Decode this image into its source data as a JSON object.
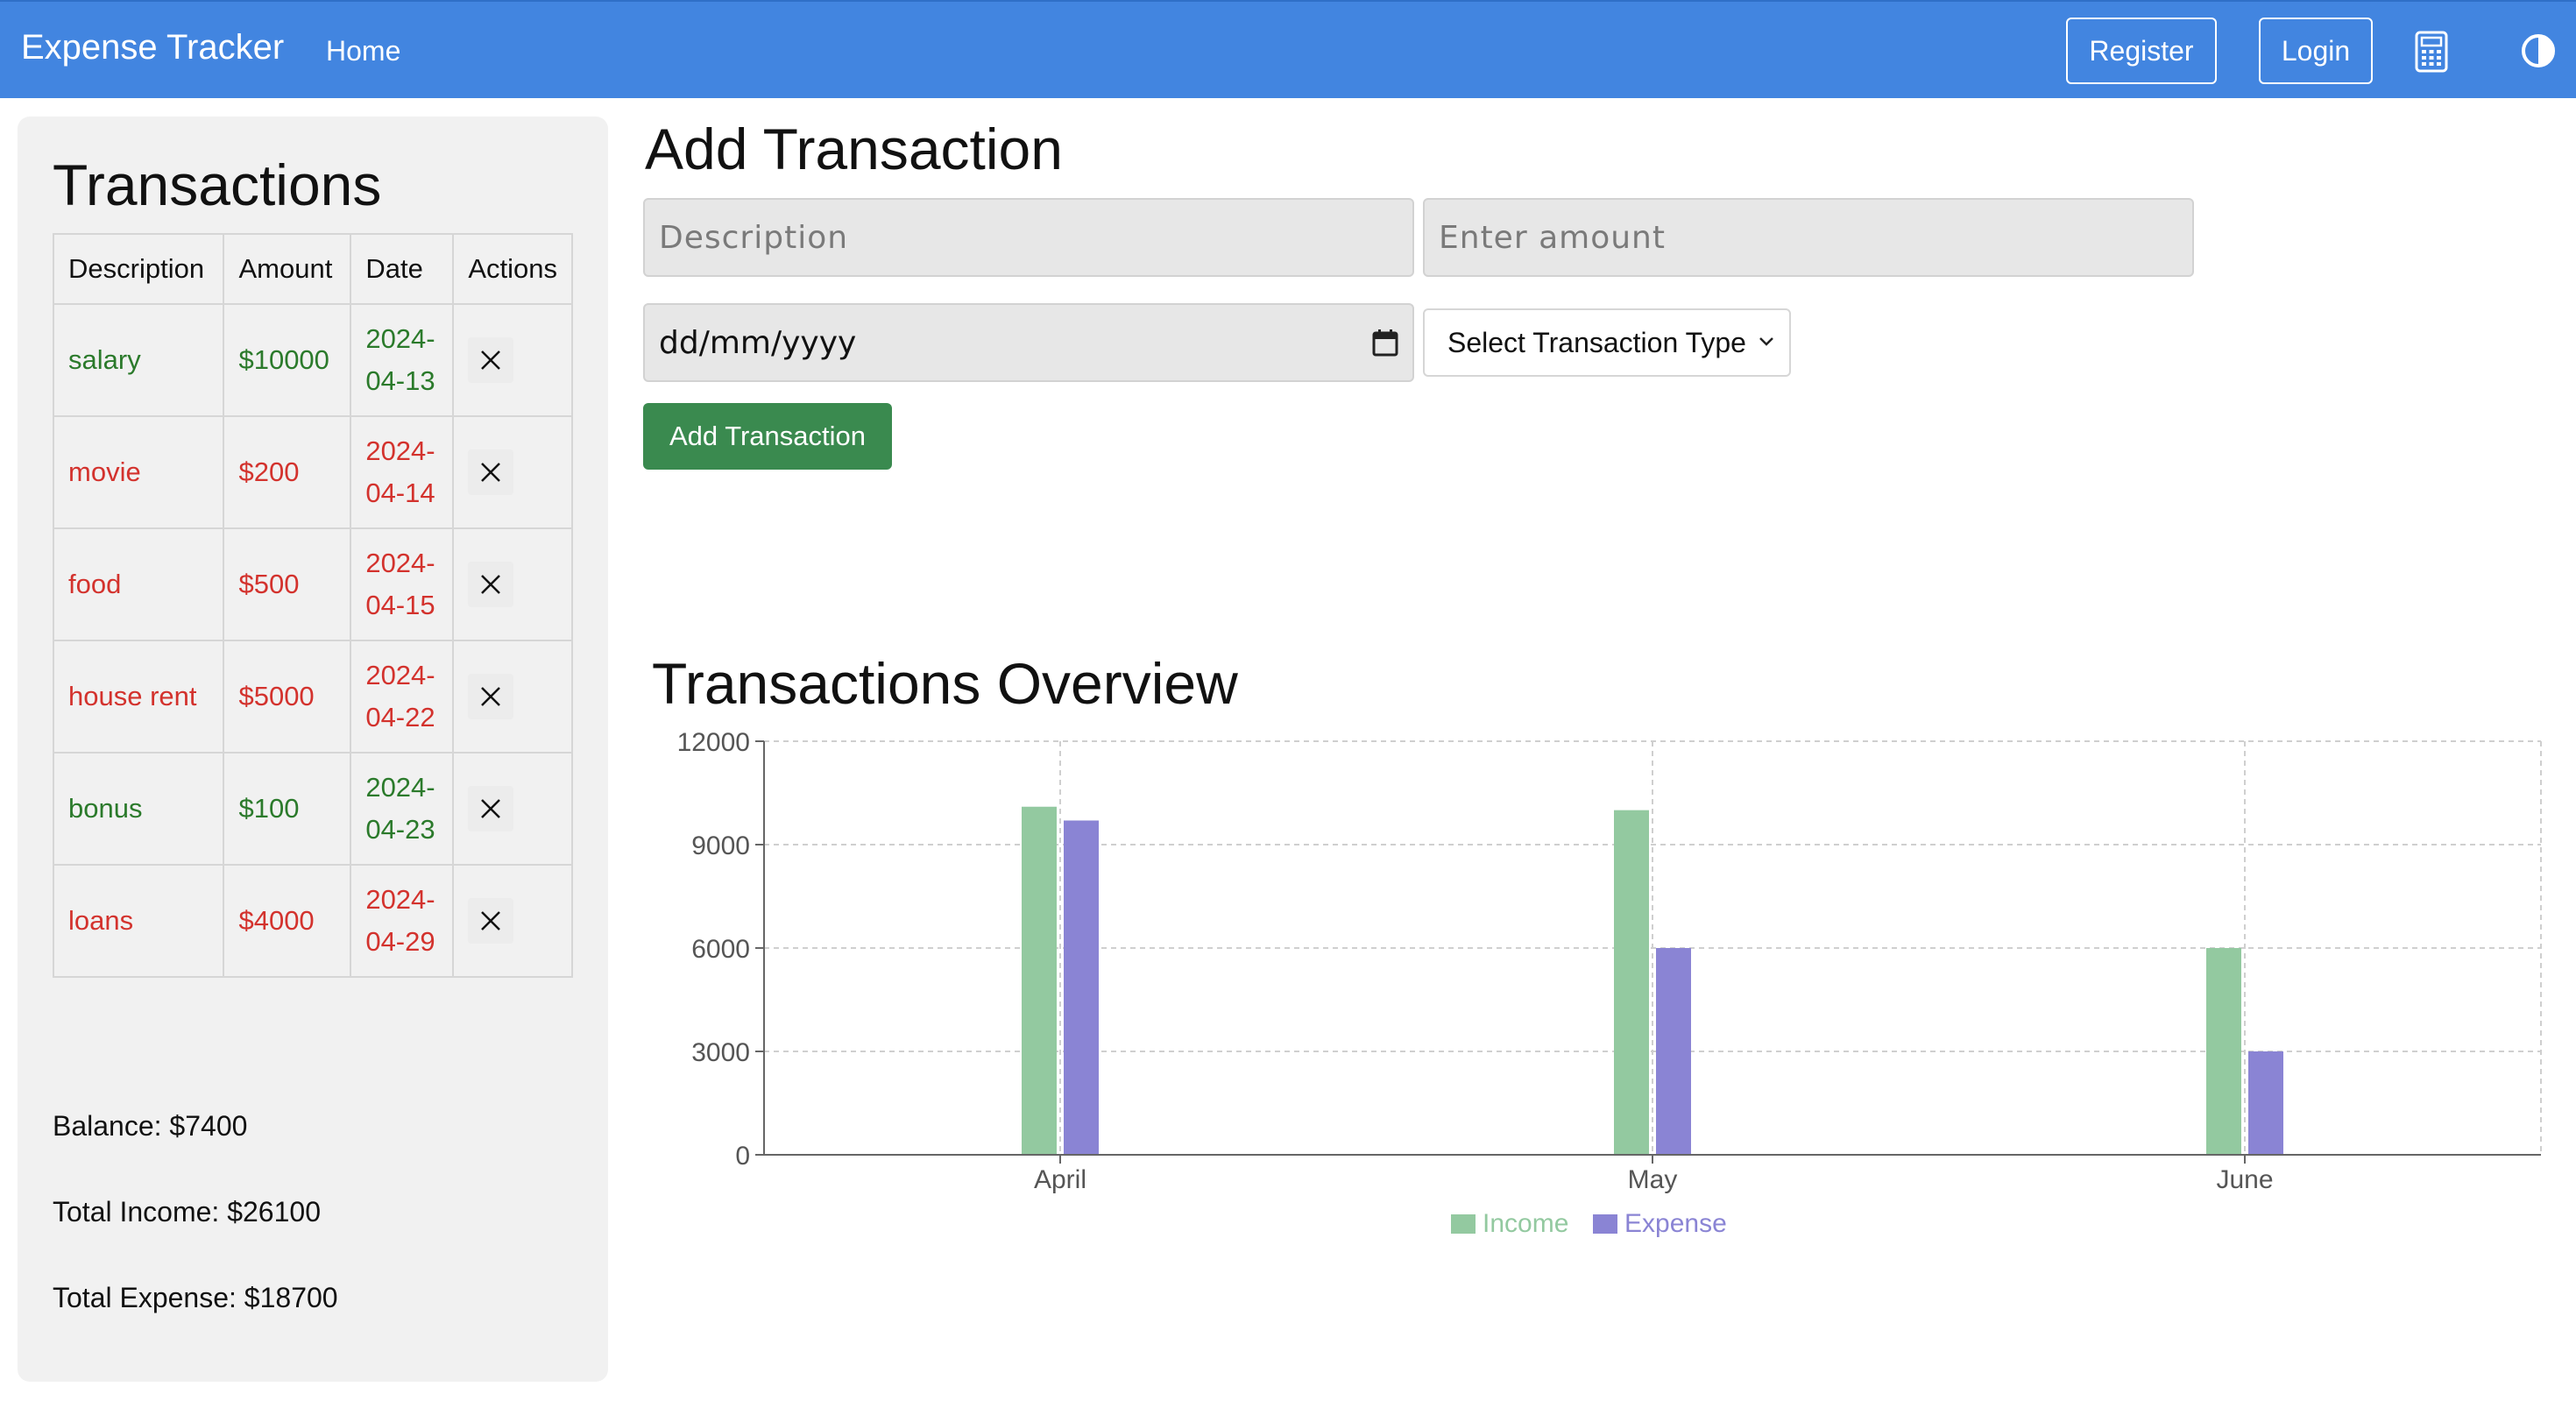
{
  "navbar": {
    "brand": "Expense Tracker",
    "home": "Home",
    "register": "Register",
    "login": "Login",
    "calculator_icon": "calculator-icon",
    "theme_icon": "contrast-icon",
    "background": "#4285e0"
  },
  "transactions": {
    "title": "Transactions",
    "headers": [
      "Description",
      "Amount",
      "Date",
      "Actions"
    ],
    "rows": [
      {
        "description": "salary",
        "amount": "$10000",
        "date": "2024-04-13",
        "type": "income"
      },
      {
        "description": "movie",
        "amount": "$200",
        "date": "2024-04-14",
        "type": "expense"
      },
      {
        "description": "food",
        "amount": "$500",
        "date": "2024-04-15",
        "type": "expense"
      },
      {
        "description": "house rent",
        "amount": "$5000",
        "date": "2024-04-22",
        "type": "expense"
      },
      {
        "description": "bonus",
        "amount": "$100",
        "date": "2024-04-23",
        "type": "income"
      },
      {
        "description": "loans",
        "amount": "$4000",
        "date": "2024-04-29",
        "type": "expense"
      }
    ],
    "delete_icon": "close-icon",
    "income_color": "#2b7a2b",
    "expense_color": "#d3322d"
  },
  "summary": {
    "balance": "Balance: $7400",
    "total_income": "Total Income: $26100",
    "total_expense": "Total Expense: $18700"
  },
  "add_form": {
    "title": "Add Transaction",
    "description_placeholder": "Description",
    "amount_placeholder": "Enter amount",
    "date_placeholder": "dd/mm/yyyy",
    "type_select": "Select Transaction Type",
    "submit": "Add Transaction",
    "submit_color": "#3a8a4f"
  },
  "chart_data": {
    "type": "bar",
    "title": "Transactions Overview",
    "categories": [
      "April",
      "May",
      "June"
    ],
    "series": [
      {
        "name": "Income",
        "values": [
          10100,
          10000,
          6000
        ],
        "color": "#93c9a0"
      },
      {
        "name": "Expense",
        "values": [
          9700,
          6000,
          3000
        ],
        "color": "#8a84d4"
      }
    ],
    "ylim": [
      0,
      12000
    ],
    "yticks": [
      0,
      3000,
      6000,
      9000,
      12000
    ],
    "grid": true,
    "legend": "bottom"
  }
}
